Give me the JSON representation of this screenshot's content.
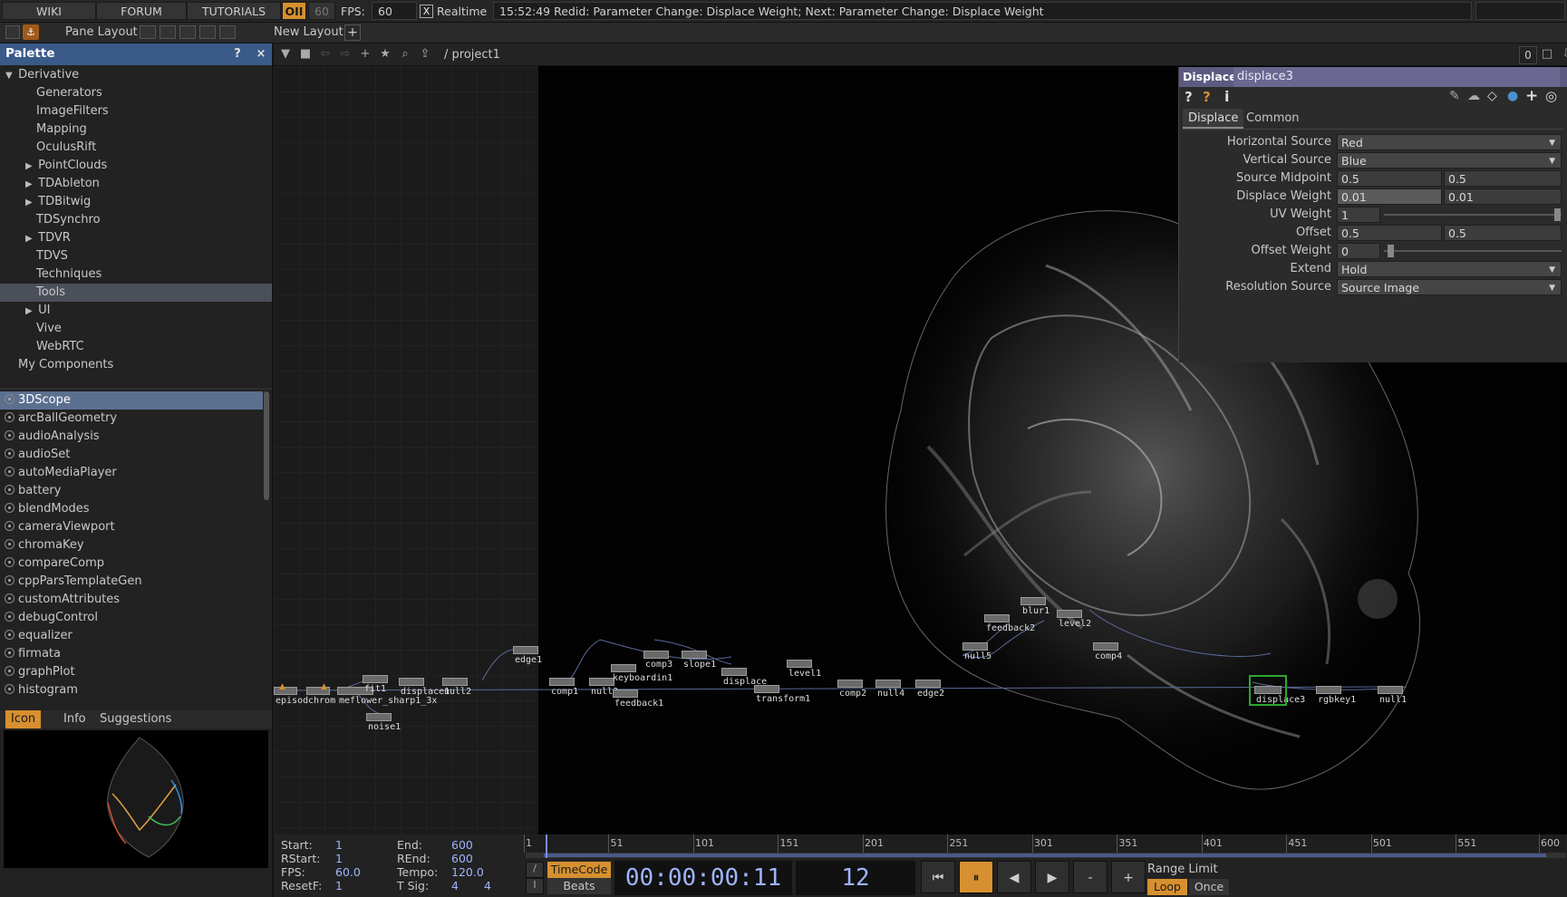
{
  "topbar": {
    "wiki": "WIKI",
    "forum": "FORUM",
    "tutorials": "TUTORIALS",
    "oii": "OII",
    "fps_field": "60",
    "fps_label": "FPS:",
    "fps_value": "60",
    "realtime_check": "X",
    "realtime_label": "Realtime",
    "status": "15:52:49 Redid: Parameter Change: Displace Weight; Next: Parameter Change: Displace Weight"
  },
  "layoutbar": {
    "pane_layout": "Pane Layout",
    "new_layout": "New Layout",
    "add": "+"
  },
  "palette": {
    "title": "Palette",
    "help": "?",
    "close": "×",
    "tree": [
      {
        "label": "Derivative",
        "arrow": "▼"
      },
      {
        "label": "Generators",
        "arrow": ""
      },
      {
        "label": "ImageFilters",
        "arrow": ""
      },
      {
        "label": "Mapping",
        "arrow": ""
      },
      {
        "label": "OculusRift",
        "arrow": ""
      },
      {
        "label": "PointClouds",
        "arrow": "▶"
      },
      {
        "label": "TDAbleton",
        "arrow": "▶"
      },
      {
        "label": "TDBitwig",
        "arrow": "▶"
      },
      {
        "label": "TDSynchro",
        "arrow": ""
      },
      {
        "label": "TDVR",
        "arrow": "▶"
      },
      {
        "label": "TDVS",
        "arrow": ""
      },
      {
        "label": "Techniques",
        "arrow": ""
      },
      {
        "label": "Tools",
        "arrow": ""
      },
      {
        "label": "UI",
        "arrow": "▶"
      },
      {
        "label": "Vive",
        "arrow": ""
      },
      {
        "label": "WebRTC",
        "arrow": ""
      },
      {
        "label": "My Components",
        "arrow": ""
      }
    ],
    "components": [
      "3DScope",
      "arcBallGeometry",
      "audioAnalysis",
      "audioSet",
      "autoMediaPlayer",
      "battery",
      "blendModes",
      "cameraViewport",
      "chromaKey",
      "compareComp",
      "cppParsTemplateGen",
      "customAttributes",
      "debugControl",
      "equalizer",
      "firmata",
      "graphPlot",
      "histogram"
    ],
    "tabs": [
      "Icon",
      "Info",
      "Suggestions"
    ]
  },
  "netbar": {
    "path": "/ project1",
    "right_value": "0"
  },
  "nodes": [
    "episod",
    "chrom",
    "meflower_sharp1_3x",
    "fit1",
    "noise1",
    "displace1",
    "null2",
    "edge1",
    "comp1",
    "null3",
    "keyboardin1",
    "feedback1",
    "comp3",
    "slope1",
    "displace",
    "transform1",
    "level1",
    "comp2",
    "null4",
    "edge2",
    "null5",
    "feedback2",
    "blur1",
    "level2",
    "comp4",
    "displace3",
    "rgbkey1",
    "null1"
  ],
  "params": {
    "op_type": "Displace",
    "op_name": "displace3",
    "tabs": [
      "Displace",
      "Common"
    ],
    "rows": [
      {
        "label": "Horizontal Source",
        "v1": "Red"
      },
      {
        "label": "Vertical Source",
        "v1": "Blue"
      },
      {
        "label": "Source Midpoint",
        "v1": "0.5",
        "v2": "0.5"
      },
      {
        "label": "Displace Weight",
        "v1": "0.01",
        "v2": "0.01"
      },
      {
        "label": "UV Weight",
        "v1": "1"
      },
      {
        "label": "Offset",
        "v1": "0.5",
        "v2": "0.5"
      },
      {
        "label": "Offset Weight",
        "v1": "0"
      },
      {
        "label": "Extend",
        "v1": "Hold"
      },
      {
        "label": "Resolution Source",
        "v1": "Source Image"
      }
    ]
  },
  "timeline": {
    "start_label": "Start:",
    "start": "1",
    "end_label": "End:",
    "end": "600",
    "rstart_label": "RStart:",
    "rstart": "1",
    "rend_label": "REnd:",
    "rend": "600",
    "fps_label": "FPS:",
    "fps": "60.0",
    "tempo_label": "Tempo:",
    "tempo": "120.0",
    "resetf_label": "ResetF:",
    "resetf": "1",
    "tsig_label": "T Sig:",
    "tsig_a": "4",
    "tsig_b": "4",
    "ticks": [
      "1",
      "51",
      "101",
      "151",
      "201",
      "251",
      "301",
      "351",
      "401",
      "451",
      "501",
      "551",
      "600"
    ],
    "timecode_btn": "TimeCode",
    "beats_btn": "Beats",
    "timecode": "00:00:00:11",
    "frame": "12",
    "range_limit": "Range Limit",
    "loop": "Loop",
    "once": "Once",
    "transport": [
      "⏮",
      "⏸",
      "◀",
      "▶",
      "-",
      "+"
    ]
  },
  "colors": {
    "palette_header": "#3a5a8a",
    "param_header": "#5c5a80",
    "accent_orange": "#d6902f",
    "selected_node": "#2ea62e",
    "timeline_value": "#9fb4ff"
  }
}
